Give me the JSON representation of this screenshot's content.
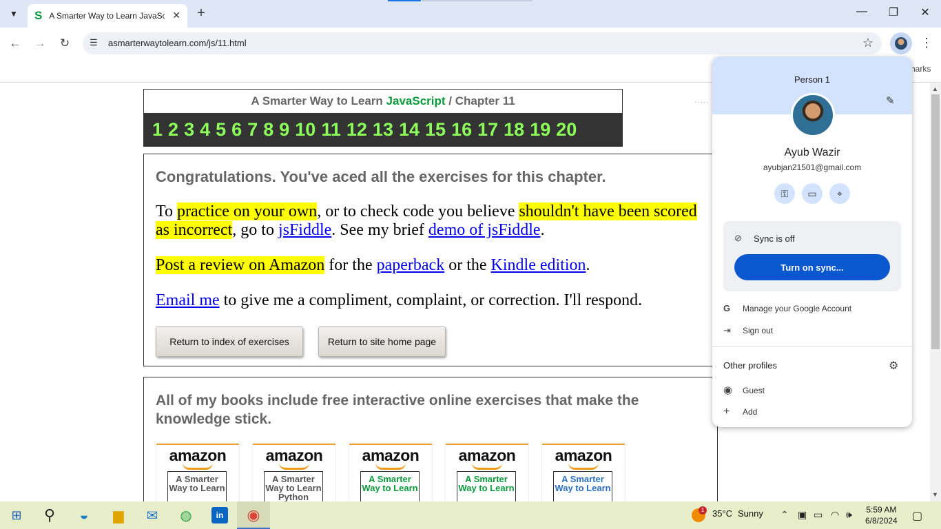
{
  "browser": {
    "tab_title": "A Smarter Way to Learn JavaScript",
    "tab_favicon": "S",
    "url": "asmarterwaytolearn.com/js/11.html",
    "bookmarks_fragment": "narks"
  },
  "page": {
    "chapter_header": {
      "prefix": "A Smarter Way to Learn",
      "subject": "JavaScript",
      "separator": "/",
      "chapter": "Chapter 11"
    },
    "chapter_numbers": [
      "1",
      "2",
      "3",
      "4",
      "5",
      "6",
      "7",
      "8",
      "9",
      "10",
      "11",
      "12",
      "13",
      "14",
      "15",
      "16",
      "17",
      "18",
      "19",
      "20"
    ],
    "congrats_heading": "Congratulations. You've aced all the exercises for this chapter.",
    "para1": {
      "t1": "To ",
      "h1": "practice on your own",
      "t2": ", or to check code you believe ",
      "h2": "shouldn't have been scored as incorrect",
      "t3": ", go to ",
      "l1": "jsFiddle",
      "t4": ". See my brief ",
      "l2": "demo of jsFiddle",
      "t5": "."
    },
    "para2": {
      "h1": "Post a review on Amazon",
      "t1": " for the ",
      "l1": "paperback",
      "t2": " or the ",
      "l2": "Kindle edition",
      "t3": "."
    },
    "para3": {
      "l1": "Email me",
      "t1": " to give me a compliment, complaint, or correction. I'll respond."
    },
    "buttons": {
      "index": "Return to index of exercises",
      "home": "Return to site home page"
    },
    "books_heading": "All of my books include free interactive online exercises that make the knowledge stick.",
    "books": [
      {
        "brand": "amazon",
        "cover": "A Smarter Way to Learn",
        "color": "#555555"
      },
      {
        "brand": "amazon",
        "cover": "A Smarter Way to Learn Python",
        "color": "#555555"
      },
      {
        "brand": "amazon",
        "cover": "A Smarter Way to Learn",
        "color": "#0a9a3a"
      },
      {
        "brand": "amazon",
        "cover": "A Smarter Way to Learn",
        "color": "#0a9a3a"
      },
      {
        "brand": "amazon",
        "cover": "A Smarter Way to Learn",
        "color": "#2a6fc0"
      }
    ]
  },
  "profile_menu": {
    "person": "Person 1",
    "name": "Ayub Wazir",
    "email": "ayubjan21501@gmail.com",
    "sync_status": "Sync is off",
    "sync_button": "Turn on sync...",
    "manage": "Manage your Google Account",
    "signout": "Sign out",
    "other_profiles": "Other profiles",
    "guest": "Guest",
    "add": "Add"
  },
  "taskbar": {
    "temperature": "35°C",
    "weather": "Sunny",
    "weather_badge": "1",
    "time": "5:59 AM",
    "date": "6/8/2024"
  },
  "colors": {
    "accent": "#0b57d0",
    "highlight": "#ffff00",
    "chapter_nums": "#8cff5a",
    "js_green": "#0a9a3a"
  }
}
